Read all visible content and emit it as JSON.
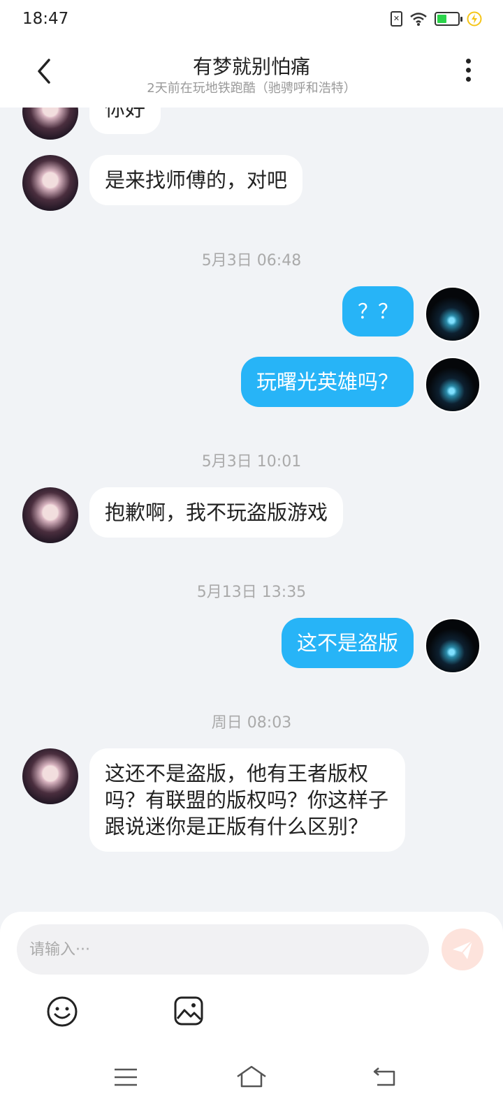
{
  "status_bar": {
    "time": "18:47",
    "sim_glyph": "✕",
    "battery_color": "#2bd44b"
  },
  "header": {
    "title": "有梦就别怕痛",
    "subtitle": "2天前在玩地铁跑酷（驰骋呼和浩特）"
  },
  "chat": {
    "messages": [
      {
        "side": "left",
        "text": "你好"
      },
      {
        "side": "left",
        "text": "是来找师傅的，对吧"
      },
      {
        "time": "5月3日 06:48"
      },
      {
        "side": "right",
        "text": "？？"
      },
      {
        "side": "right",
        "text": "玩曙光英雄吗？"
      },
      {
        "time": "5月3日 10:01"
      },
      {
        "side": "left",
        "text": "抱歉啊，我不玩盗版游戏"
      },
      {
        "time": "5月13日 13:35"
      },
      {
        "side": "right",
        "text": "这不是盗版"
      },
      {
        "time": "周日 08:03"
      },
      {
        "side": "left",
        "text": "这还不是盗版，他有王者版权吗？有联盟的版权吗？你这样子跟说迷你是正版有什么区别？"
      }
    ]
  },
  "input": {
    "placeholder": "请输入···"
  },
  "colors": {
    "my_bubble": "#27b4f7",
    "other_bubble": "#ffffff",
    "send_button": "#fde3dc"
  }
}
